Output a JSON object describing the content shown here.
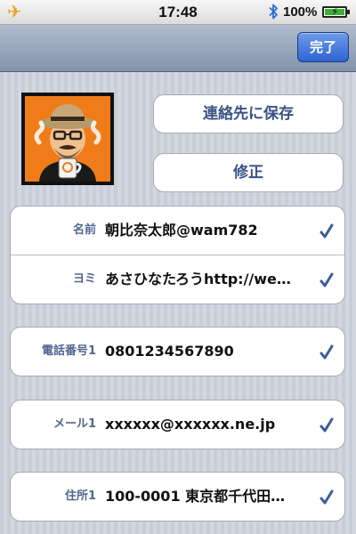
{
  "status_bar": {
    "airplane_icon": "airplane-icon",
    "time": "17:48",
    "bluetooth_icon": "bluetooth-icon",
    "battery_percent": "100%",
    "battery_level": 1.0,
    "battery_color": "#3cb034"
  },
  "navbar": {
    "done_label": "完了"
  },
  "actions": {
    "save_contact": "連絡先に保存",
    "edit": "修正"
  },
  "fields": {
    "name": {
      "label": "名前",
      "value": "朝比奈太郎@wam782"
    },
    "reading": {
      "label": "ヨミ",
      "value": "あさひなたろうhttp://we…"
    },
    "phone": {
      "label": "電話番号1",
      "value": "0801234567890"
    },
    "email": {
      "label": "メール1",
      "value": "xxxxxx@xxxxxx.ne.jp"
    },
    "address": {
      "label": "住所1",
      "value": "100-0001 東京都千代田…"
    }
  },
  "colors": {
    "accent": "#3a5384",
    "label": "#51678f",
    "done_button": "#2f63d2",
    "check": "#3a5d9a"
  }
}
